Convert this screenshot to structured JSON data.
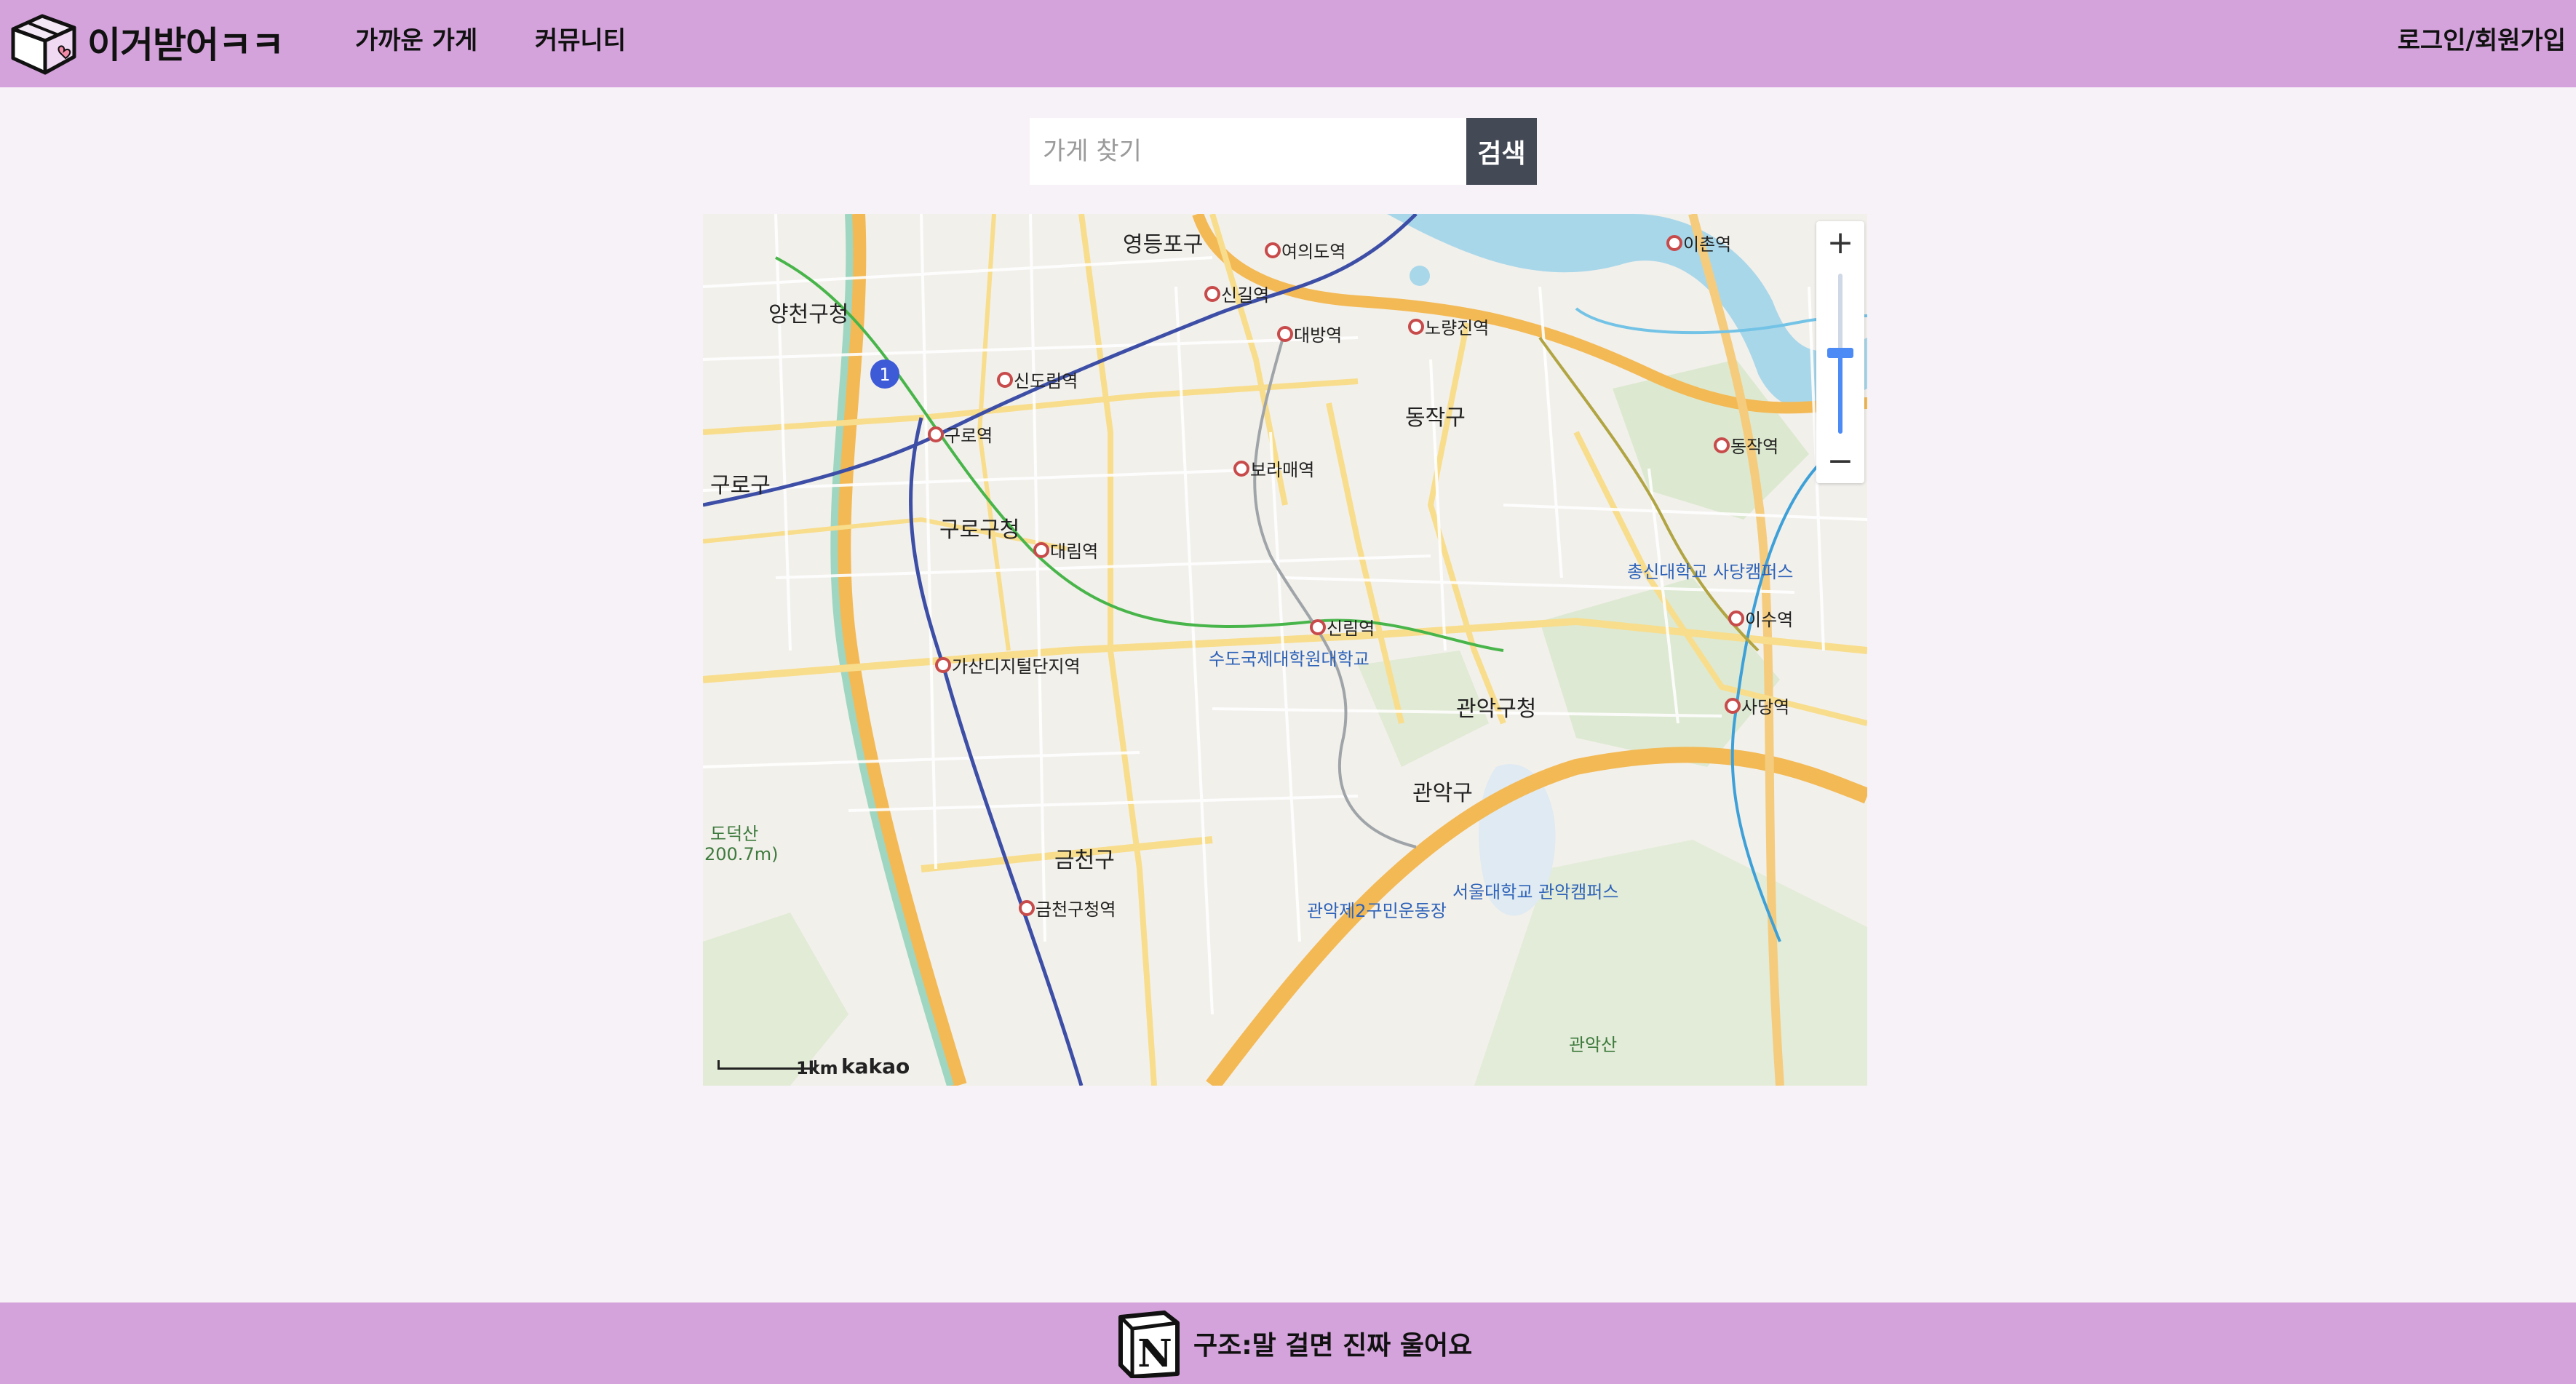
{
  "header": {
    "logo_text": "이거받어ㅋㅋ",
    "nav": [
      {
        "label": "가까운 가게"
      },
      {
        "label": "커뮤니티"
      }
    ],
    "login_label": "로그인/회원가입"
  },
  "search": {
    "placeholder": "가게 찾기",
    "button_label": "검색"
  },
  "map": {
    "districts": [
      "양천구청",
      "구로구",
      "구로구청",
      "영등포구",
      "동작구",
      "관악구청",
      "관악구",
      "금천구"
    ],
    "stations": [
      "신길역",
      "대방역",
      "노량진역",
      "신도림역",
      "구로역",
      "대림역",
      "보라매역",
      "신림역",
      "가산디지털단지역",
      "금천구청역",
      "동작역",
      "이수역",
      "사당역",
      "이촌역",
      "여의도역"
    ],
    "places": [
      "서울대학교 관악캠퍼스",
      "수도국제대학원대학교",
      "총신대학교 사당캠퍼스",
      "관악산",
      "도덕산",
      "200.7m)",
      "관악제2구민운동장"
    ],
    "scale_label": "1km",
    "attribution": "kakao",
    "zoom_in_label": "+",
    "zoom_out_label": "−"
  },
  "footer": {
    "text": "구조:말 걸면 진짜 울어요"
  },
  "colors": {
    "header_bg": "#d4a3db",
    "page_bg": "#f7f2f7",
    "search_button_bg": "#434a55"
  }
}
